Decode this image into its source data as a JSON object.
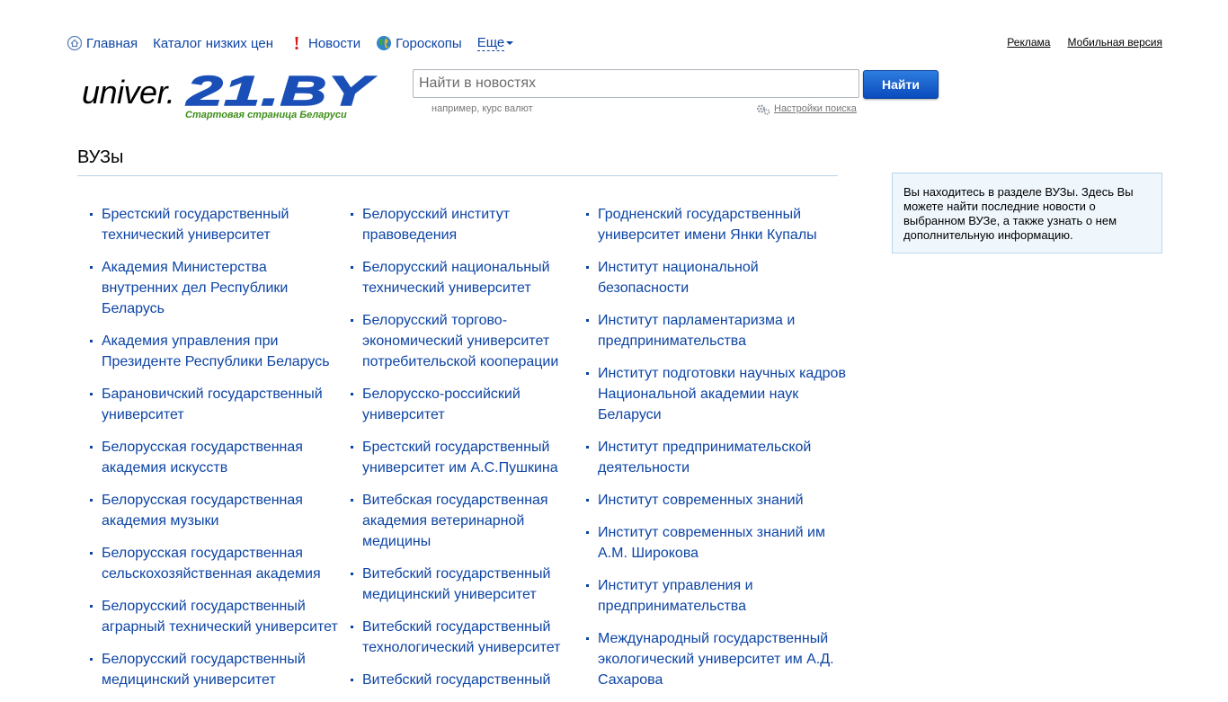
{
  "nav": {
    "items": [
      {
        "label": "Главная",
        "icon": "home-icon"
      },
      {
        "label": "Каталог низких цен",
        "icon": ""
      },
      {
        "label": "Новости",
        "icon": "exclamation-icon"
      },
      {
        "label": "Гороскопы",
        "icon": "globe-icon"
      }
    ],
    "more_label": "Еще"
  },
  "top_links": {
    "ads": "Реклама",
    "mobile": "Мобильная версия"
  },
  "logo": {
    "prefix": "univer.",
    "brand": "21.BY",
    "tagline": "Стартовая страница Беларуси"
  },
  "search": {
    "placeholder": "Найти в новостях",
    "button_label": "Найти",
    "hint": "например, курс валют",
    "settings_label": "Настройки поиска"
  },
  "section": {
    "title": "ВУЗы"
  },
  "universities": {
    "col1": [
      "Брестский государственный технический университет",
      "Академия Министерства внутренних дел Республики Беларусь",
      "Академия управления при Президенте Республики Беларусь",
      "Барановичский государственный университет",
      "Белорусская государственная академия искусств",
      "Белорусская государственная академия музыки",
      "Белорусская государственная сельскохозяйственная академия",
      "Белорусский государственный аграрный технический университет",
      "Белорусский государственный медицинский университет"
    ],
    "col2": [
      "Белорусский институт правоведения",
      "Белорусский национальный технический университет",
      "Белорусский торгово-экономический университет потребительской кооперации",
      "Белорусско-российский университет",
      "Брестский государственный университет им А.С.Пушкина",
      "Витебская государственная академия ветеринарной медицины",
      "Витебский государственный медицинский университет",
      "Витебский государственный технологический университет",
      "Витебский государственный"
    ],
    "col3": [
      "Гродненский государственный университет имени Янки Купалы",
      "Институт национальной безопасности",
      "Институт парламентаризма и предпринимательства",
      "Институт подготовки научных кадров Национальной академии наук Беларуси",
      "Институт предпринимательской деятельности",
      "Институт современных знаний",
      "Институт современных знаний им А.М. Широкова",
      "Институт управления и предпринимательства",
      "Международный государственный экологический университет им А.Д. Сахарова"
    ]
  },
  "info": {
    "text": "Вы находитесь в разделе ВУЗы. Здесь Вы можете найти последние новости о выбранном ВУЗе, а также узнать о нем дополнительную информацию."
  },
  "colors": {
    "link": "#0d45a5",
    "logo_blue": "#1a4fb8",
    "tagline_green": "#3e8e1a",
    "button": "#1563cf",
    "info_bg": "#eff7fd",
    "info_border": "#b9d6ec"
  }
}
